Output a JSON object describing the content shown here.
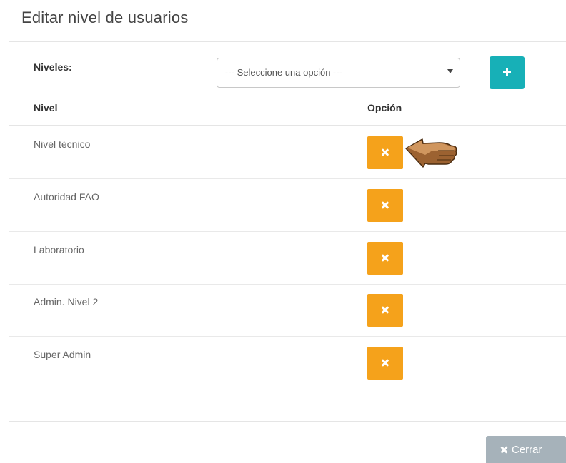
{
  "modal": {
    "title": "Editar nivel de usuarios"
  },
  "form": {
    "niveles_label": "Niveles:",
    "select_value": "--- Seleccione una opción ---",
    "add_icon": "plus-icon"
  },
  "table": {
    "headers": [
      "Nivel",
      "Opción"
    ],
    "rows": [
      {
        "label": "Nivel técnico",
        "action_icon": "times-icon"
      },
      {
        "label": "Autoridad FAO",
        "action_icon": "times-icon"
      },
      {
        "label": "Laboratorio",
        "action_icon": "times-icon"
      },
      {
        "label": "Admin. Nivel 2",
        "action_icon": "times-icon"
      },
      {
        "label": "Super Admin",
        "action_icon": "times-icon"
      }
    ]
  },
  "footer": {
    "close_label": "Cerrar",
    "close_icon": "times-icon"
  },
  "colors": {
    "add_button": "#17b0b7",
    "delete_button": "#f5a21b",
    "close_button": "#a6b2ba",
    "pointer": "#c98a4e"
  }
}
